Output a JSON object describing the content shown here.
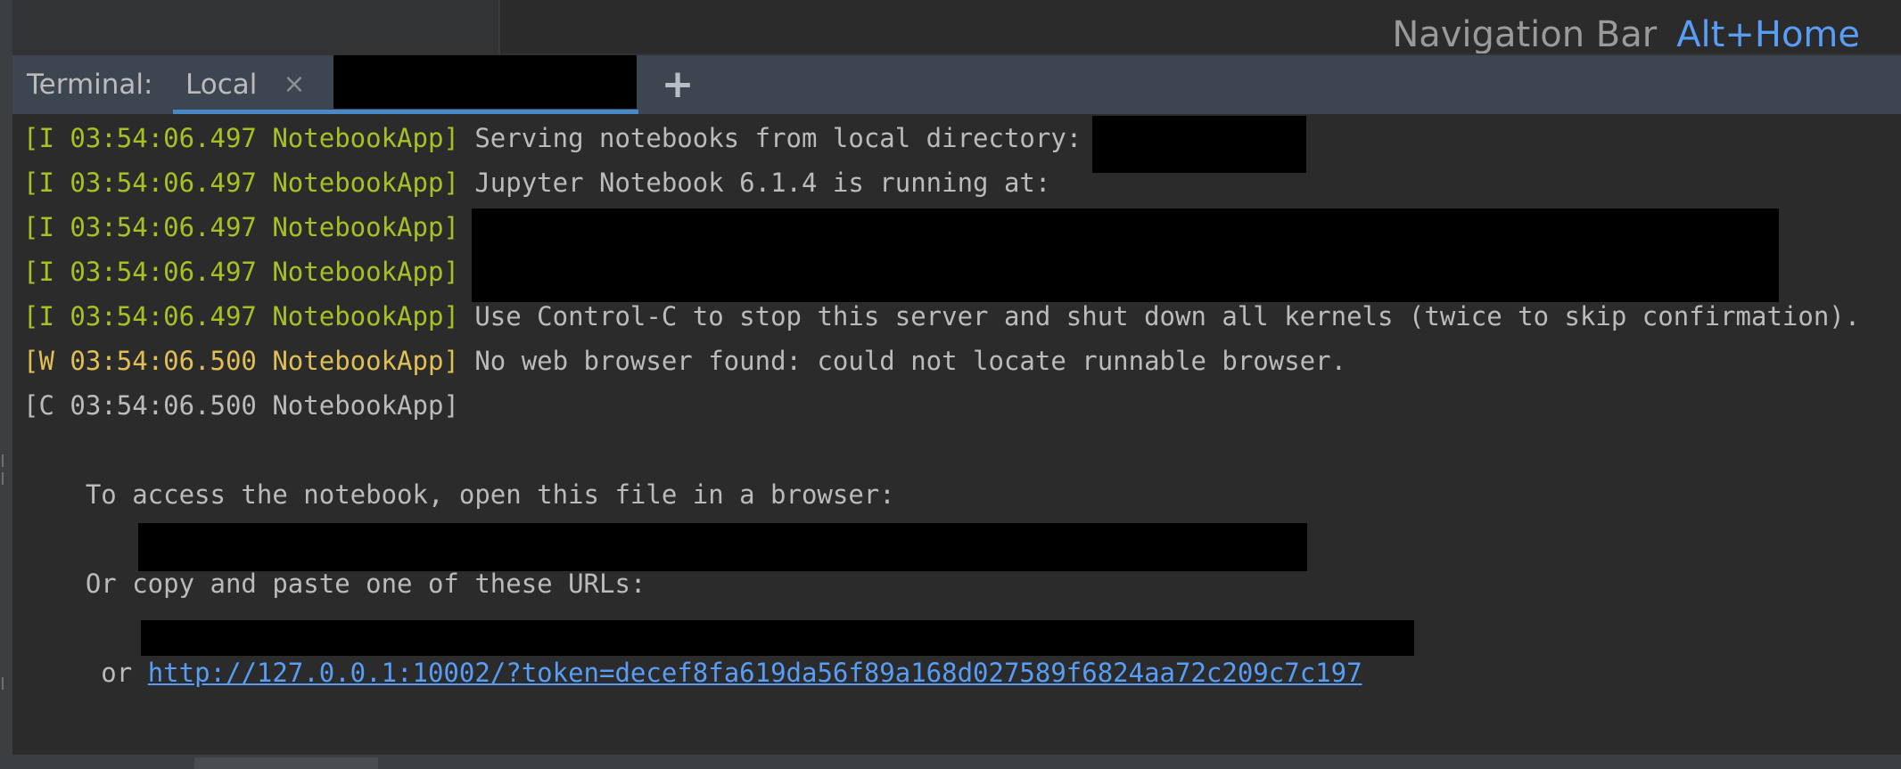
{
  "navigation_hint": {
    "label": "Navigation Bar",
    "shortcut": "Alt+Home"
  },
  "terminal_tabs": {
    "title": "Terminal:",
    "tabs": [
      {
        "label": "Local",
        "close_icon": "×"
      }
    ],
    "new_tab_icon": "+"
  },
  "terminal_lines": [
    {
      "prefix": "[I 03:54:06.497 NotebookApp]",
      "message": " Serving notebooks from local directory: "
    },
    {
      "prefix": "[I 03:54:06.497 NotebookApp]",
      "message": " Jupyter Notebook 6.1.4 is running at:"
    },
    {
      "prefix": "[I 03:54:06.497 NotebookApp]",
      "message": ""
    },
    {
      "prefix": "[I 03:54:06.497 NotebookApp]",
      "message": ""
    },
    {
      "prefix": "[I 03:54:06.497 NotebookApp]",
      "message": " Use Control-C to stop this server and shut down all kernels (twice to skip confirmation)."
    },
    {
      "prefix": "[W 03:54:06.500 NotebookApp]",
      "message": " No web browser found: could not locate runnable browser."
    },
    {
      "prefix": "[C 03:54:06.500 NotebookApp]",
      "message": ""
    }
  ],
  "notebook_instructions": {
    "access_text": "    To access the notebook, open this file in a browser:",
    "copy_text": "    Or copy and paste one of these URLs:",
    "or_text": "     or ",
    "url": "http://127.0.0.1:10002/?token=decef8fa619da56f89a168d027589f6824aa72c209c7c197"
  },
  "colors": {
    "info_prefix": "#a8c023",
    "warn_prefix": "#e0bf55",
    "link": "#589df6",
    "text": "#bbbbbb",
    "background": "#2b2b2b"
  }
}
